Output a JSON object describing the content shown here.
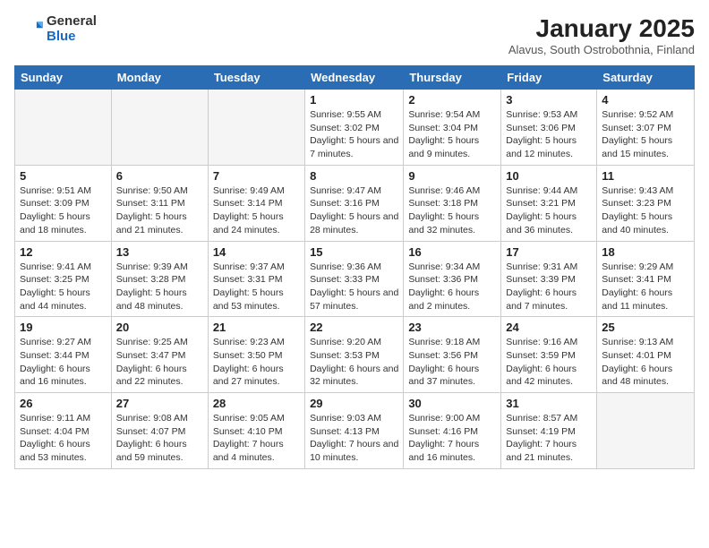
{
  "logo": {
    "general": "General",
    "blue": "Blue"
  },
  "title": "January 2025",
  "subtitle": "Alavus, South Ostrobothnia, Finland",
  "headers": [
    "Sunday",
    "Monday",
    "Tuesday",
    "Wednesday",
    "Thursday",
    "Friday",
    "Saturday"
  ],
  "weeks": [
    [
      {
        "num": "",
        "info": ""
      },
      {
        "num": "",
        "info": ""
      },
      {
        "num": "",
        "info": ""
      },
      {
        "num": "1",
        "info": "Sunrise: 9:55 AM\nSunset: 3:02 PM\nDaylight: 5 hours and 7 minutes."
      },
      {
        "num": "2",
        "info": "Sunrise: 9:54 AM\nSunset: 3:04 PM\nDaylight: 5 hours and 9 minutes."
      },
      {
        "num": "3",
        "info": "Sunrise: 9:53 AM\nSunset: 3:06 PM\nDaylight: 5 hours and 12 minutes."
      },
      {
        "num": "4",
        "info": "Sunrise: 9:52 AM\nSunset: 3:07 PM\nDaylight: 5 hours and 15 minutes."
      }
    ],
    [
      {
        "num": "5",
        "info": "Sunrise: 9:51 AM\nSunset: 3:09 PM\nDaylight: 5 hours and 18 minutes."
      },
      {
        "num": "6",
        "info": "Sunrise: 9:50 AM\nSunset: 3:11 PM\nDaylight: 5 hours and 21 minutes."
      },
      {
        "num": "7",
        "info": "Sunrise: 9:49 AM\nSunset: 3:14 PM\nDaylight: 5 hours and 24 minutes."
      },
      {
        "num": "8",
        "info": "Sunrise: 9:47 AM\nSunset: 3:16 PM\nDaylight: 5 hours and 28 minutes."
      },
      {
        "num": "9",
        "info": "Sunrise: 9:46 AM\nSunset: 3:18 PM\nDaylight: 5 hours and 32 minutes."
      },
      {
        "num": "10",
        "info": "Sunrise: 9:44 AM\nSunset: 3:21 PM\nDaylight: 5 hours and 36 minutes."
      },
      {
        "num": "11",
        "info": "Sunrise: 9:43 AM\nSunset: 3:23 PM\nDaylight: 5 hours and 40 minutes."
      }
    ],
    [
      {
        "num": "12",
        "info": "Sunrise: 9:41 AM\nSunset: 3:25 PM\nDaylight: 5 hours and 44 minutes."
      },
      {
        "num": "13",
        "info": "Sunrise: 9:39 AM\nSunset: 3:28 PM\nDaylight: 5 hours and 48 minutes."
      },
      {
        "num": "14",
        "info": "Sunrise: 9:37 AM\nSunset: 3:31 PM\nDaylight: 5 hours and 53 minutes."
      },
      {
        "num": "15",
        "info": "Sunrise: 9:36 AM\nSunset: 3:33 PM\nDaylight: 5 hours and 57 minutes."
      },
      {
        "num": "16",
        "info": "Sunrise: 9:34 AM\nSunset: 3:36 PM\nDaylight: 6 hours and 2 minutes."
      },
      {
        "num": "17",
        "info": "Sunrise: 9:31 AM\nSunset: 3:39 PM\nDaylight: 6 hours and 7 minutes."
      },
      {
        "num": "18",
        "info": "Sunrise: 9:29 AM\nSunset: 3:41 PM\nDaylight: 6 hours and 11 minutes."
      }
    ],
    [
      {
        "num": "19",
        "info": "Sunrise: 9:27 AM\nSunset: 3:44 PM\nDaylight: 6 hours and 16 minutes."
      },
      {
        "num": "20",
        "info": "Sunrise: 9:25 AM\nSunset: 3:47 PM\nDaylight: 6 hours and 22 minutes."
      },
      {
        "num": "21",
        "info": "Sunrise: 9:23 AM\nSunset: 3:50 PM\nDaylight: 6 hours and 27 minutes."
      },
      {
        "num": "22",
        "info": "Sunrise: 9:20 AM\nSunset: 3:53 PM\nDaylight: 6 hours and 32 minutes."
      },
      {
        "num": "23",
        "info": "Sunrise: 9:18 AM\nSunset: 3:56 PM\nDaylight: 6 hours and 37 minutes."
      },
      {
        "num": "24",
        "info": "Sunrise: 9:16 AM\nSunset: 3:59 PM\nDaylight: 6 hours and 42 minutes."
      },
      {
        "num": "25",
        "info": "Sunrise: 9:13 AM\nSunset: 4:01 PM\nDaylight: 6 hours and 48 minutes."
      }
    ],
    [
      {
        "num": "26",
        "info": "Sunrise: 9:11 AM\nSunset: 4:04 PM\nDaylight: 6 hours and 53 minutes."
      },
      {
        "num": "27",
        "info": "Sunrise: 9:08 AM\nSunset: 4:07 PM\nDaylight: 6 hours and 59 minutes."
      },
      {
        "num": "28",
        "info": "Sunrise: 9:05 AM\nSunset: 4:10 PM\nDaylight: 7 hours and 4 minutes."
      },
      {
        "num": "29",
        "info": "Sunrise: 9:03 AM\nSunset: 4:13 PM\nDaylight: 7 hours and 10 minutes."
      },
      {
        "num": "30",
        "info": "Sunrise: 9:00 AM\nSunset: 4:16 PM\nDaylight: 7 hours and 16 minutes."
      },
      {
        "num": "31",
        "info": "Sunrise: 8:57 AM\nSunset: 4:19 PM\nDaylight: 7 hours and 21 minutes."
      },
      {
        "num": "",
        "info": ""
      }
    ]
  ]
}
